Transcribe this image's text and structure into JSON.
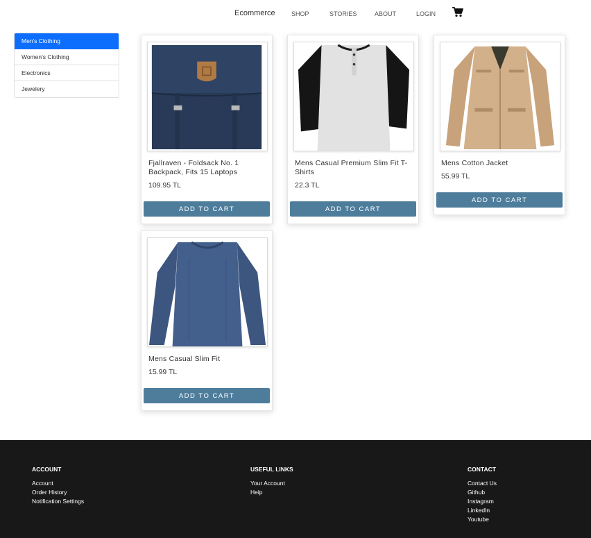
{
  "nav": {
    "brand": "Ecommerce",
    "links": [
      "SHOP",
      "STORIES",
      "ABOUT",
      "LOGIN"
    ],
    "cart_icon": "shopping-cart-icon"
  },
  "categories": [
    {
      "label": "Men's Clothing",
      "active": true
    },
    {
      "label": "Women's Clothing",
      "active": false
    },
    {
      "label": "Electronics",
      "active": false
    },
    {
      "label": "Jewelery",
      "active": false
    }
  ],
  "products": [
    {
      "title": "Fjallraven - Foldsack No. 1 Backpack, Fits 15 Laptops",
      "price": "109.95 TL",
      "button": "ADD TO CART",
      "image": "navy backpack"
    },
    {
      "title": "Mens Casual Premium Slim Fit T-Shirts",
      "price": "22.3 TL",
      "button": "ADD TO CART",
      "image": "grey raglan t-shirt with black sleeves"
    },
    {
      "title": "Mens Cotton Jacket",
      "price": "55.99 TL",
      "button": "ADD TO CART",
      "image": "beige cotton jacket"
    },
    {
      "title": "Mens Casual Slim Fit",
      "price": "15.99 TL",
      "button": "ADD TO CART",
      "image": "blue long-sleeve shirt"
    }
  ],
  "footer": {
    "account": {
      "heading": "ACCOUNT",
      "links": [
        "Account",
        "Order History",
        "Notification Settings"
      ]
    },
    "useful": {
      "heading": "USEFUL LINKS",
      "links": [
        "Your Account",
        "Help"
      ]
    },
    "contact": {
      "heading": "CONTACT",
      "links": [
        "Contact Us",
        "Github",
        "Instagram",
        "LinkedIn",
        "Youtube"
      ]
    }
  },
  "colors": {
    "active_category": "#0d6efd",
    "button": "#4e7d9c",
    "footer_bg": "#181818"
  }
}
